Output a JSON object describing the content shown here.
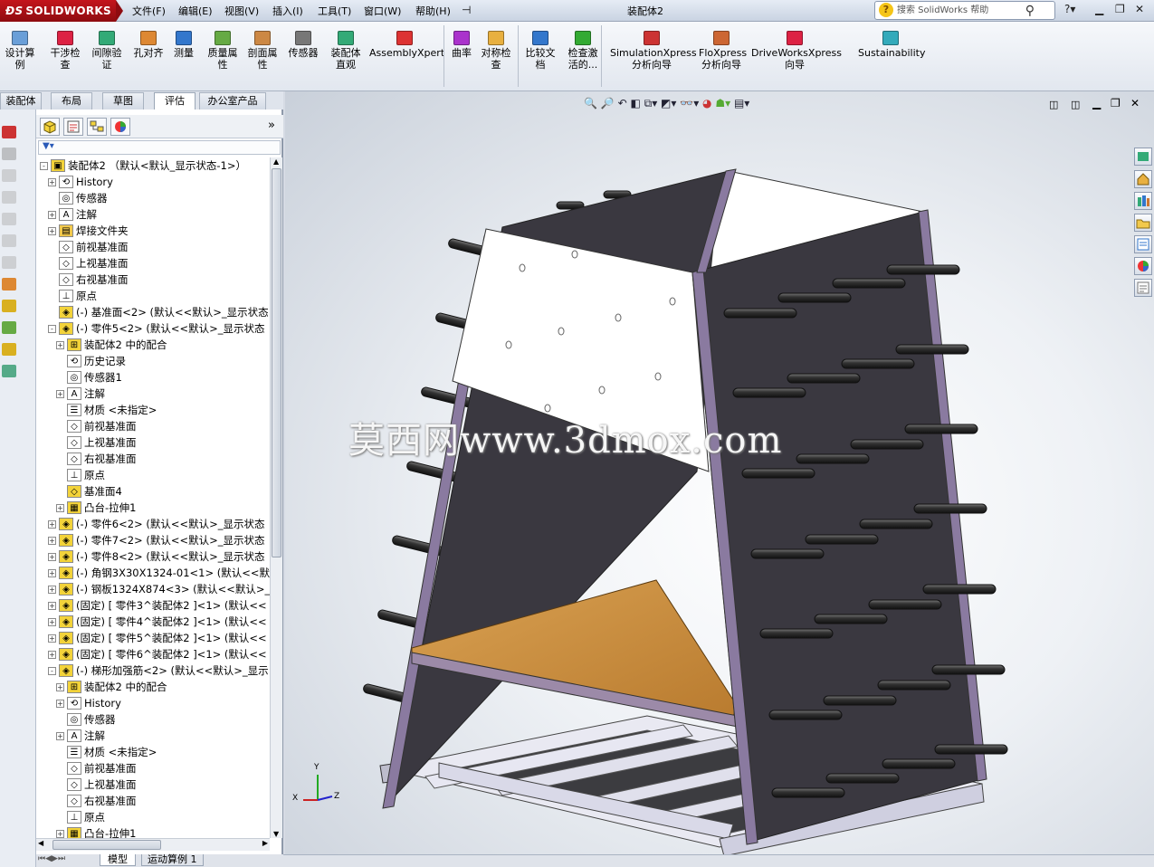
{
  "app": {
    "logo_text": "SOLIDWORKS",
    "window_title": "装配体2",
    "menu": [
      "文件(F)",
      "编辑(E)",
      "视图(V)",
      "插入(I)",
      "工具(T)",
      "窗口(W)",
      "帮助(H)"
    ],
    "help_search_placeholder": "搜索 SolidWorks 帮助"
  },
  "toolbar": {
    "items": [
      {
        "label1": "设计算",
        "label2": "例",
        "icon": "design-study-icon"
      },
      {
        "label1": "干涉检",
        "label2": "查",
        "icon": "interference-icon"
      },
      {
        "label1": "间隙验",
        "label2": "证",
        "icon": "clearance-icon"
      },
      {
        "label1": "孔对齐",
        "label2": "",
        "icon": "hole-align-icon"
      },
      {
        "label1": "测量",
        "label2": "",
        "icon": "measure-icon"
      },
      {
        "label1": "质量属",
        "label2": "性",
        "icon": "mass-props-icon"
      },
      {
        "label1": "剖面属",
        "label2": "性",
        "icon": "section-props-icon"
      },
      {
        "label1": "传感器",
        "label2": "",
        "icon": "sensor-icon"
      },
      {
        "label1": "装配体",
        "label2": "直观",
        "icon": "assembly-visual-icon"
      },
      {
        "label1": "AssemblyXpert",
        "label2": "",
        "icon": "assemblyxpert-icon"
      },
      {
        "label1": "曲率",
        "label2": "",
        "icon": "curvature-icon"
      },
      {
        "label1": "对称检",
        "label2": "查",
        "icon": "symmetry-icon"
      },
      {
        "label1": "比较文",
        "label2": "档",
        "icon": "compare-icon"
      },
      {
        "label1": "检查激",
        "label2": "活的...",
        "icon": "check-icon"
      },
      {
        "label1": "SimulationXpress",
        "label2": "分析向导",
        "icon": "simulation-icon"
      },
      {
        "label1": "FloXpress",
        "label2": "分析向导",
        "icon": "floxpress-icon"
      },
      {
        "label1": "DriveWorksXpress",
        "label2": "向导",
        "icon": "driveworks-icon"
      },
      {
        "label1": "Sustainability",
        "label2": "",
        "icon": "sustainability-icon"
      }
    ]
  },
  "cmd_tabs": [
    "装配体",
    "布局",
    "草图",
    "评估",
    "办公室产品"
  ],
  "tree": [
    {
      "text": "装配体2 （默认<默认_显示状态-1>）",
      "indent": 0,
      "exp": "-",
      "icon": "assembly-icon"
    },
    {
      "text": "History",
      "indent": 1,
      "exp": "+",
      "icon": "history-icon"
    },
    {
      "text": "传感器",
      "indent": 1,
      "exp": "",
      "icon": "sensor-icon"
    },
    {
      "text": "注解",
      "indent": 1,
      "exp": "+",
      "icon": "annotation-icon"
    },
    {
      "text": "焊接文件夹",
      "indent": 1,
      "exp": "+",
      "icon": "weldment-folder-icon"
    },
    {
      "text": "前视基准面",
      "indent": 1,
      "exp": "",
      "icon": "plane-icon"
    },
    {
      "text": "上视基准面",
      "indent": 1,
      "exp": "",
      "icon": "plane-icon"
    },
    {
      "text": "右视基准面",
      "indent": 1,
      "exp": "",
      "icon": "plane-icon"
    },
    {
      "text": "原点",
      "indent": 1,
      "exp": "",
      "icon": "origin-icon"
    },
    {
      "text": "(-) 基准面<2> (默认<<默认>_显示状态",
      "indent": 1,
      "exp": "",
      "icon": "part-icon"
    },
    {
      "text": "(-) 零件5<2> (默认<<默认>_显示状态",
      "indent": 1,
      "exp": "-",
      "icon": "part-icon"
    },
    {
      "text": "装配体2 中的配合",
      "indent": 2,
      "exp": "+",
      "icon": "mates-icon"
    },
    {
      "text": "历史记录",
      "indent": 2,
      "exp": "",
      "icon": "history-icon"
    },
    {
      "text": "传感器1",
      "indent": 2,
      "exp": "",
      "icon": "sensor-icon"
    },
    {
      "text": "注解",
      "indent": 2,
      "exp": "+",
      "icon": "annotation-icon"
    },
    {
      "text": "材质 <未指定>",
      "indent": 2,
      "exp": "",
      "icon": "material-icon"
    },
    {
      "text": "前视基准面",
      "indent": 2,
      "exp": "",
      "icon": "plane-icon"
    },
    {
      "text": "上视基准面",
      "indent": 2,
      "exp": "",
      "icon": "plane-icon"
    },
    {
      "text": "右视基准面",
      "indent": 2,
      "exp": "",
      "icon": "plane-icon"
    },
    {
      "text": "原点",
      "indent": 2,
      "exp": "",
      "icon": "origin-icon"
    },
    {
      "text": "基准面4",
      "indent": 2,
      "exp": "",
      "icon": "plane-yellow-icon"
    },
    {
      "text": "凸台-拉伸1",
      "indent": 2,
      "exp": "+",
      "icon": "extrude-icon"
    },
    {
      "text": "(-) 零件6<2> (默认<<默认>_显示状态",
      "indent": 1,
      "exp": "+",
      "icon": "part-icon"
    },
    {
      "text": "(-) 零件7<2> (默认<<默认>_显示状态",
      "indent": 1,
      "exp": "+",
      "icon": "part-icon"
    },
    {
      "text": "(-) 零件8<2> (默认<<默认>_显示状态",
      "indent": 1,
      "exp": "+",
      "icon": "part-icon"
    },
    {
      "text": "(-) 角钢3X30X1324-01<1> (默认<<默",
      "indent": 1,
      "exp": "+",
      "icon": "part-icon"
    },
    {
      "text": "(-) 钢板1324X874<3> (默认<<默认>_",
      "indent": 1,
      "exp": "+",
      "icon": "part-icon"
    },
    {
      "text": "(固定) [ 零件3^装配体2 ]<1> (默认<<",
      "indent": 1,
      "exp": "+",
      "icon": "part-icon"
    },
    {
      "text": "(固定) [ 零件4^装配体2 ]<1> (默认<<",
      "indent": 1,
      "exp": "+",
      "icon": "part-icon"
    },
    {
      "text": "(固定) [ 零件5^装配体2 ]<1> (默认<<",
      "indent": 1,
      "exp": "+",
      "icon": "part-icon"
    },
    {
      "text": "(固定) [ 零件6^装配体2 ]<1> (默认<<",
      "indent": 1,
      "exp": "+",
      "icon": "part-icon"
    },
    {
      "text": "(-) 梯形加强筋<2> (默认<<默认>_显示",
      "indent": 1,
      "exp": "-",
      "icon": "part-icon"
    },
    {
      "text": "装配体2 中的配合",
      "indent": 2,
      "exp": "+",
      "icon": "mates-icon"
    },
    {
      "text": "History",
      "indent": 2,
      "exp": "+",
      "icon": "history-icon"
    },
    {
      "text": "传感器",
      "indent": 2,
      "exp": "",
      "icon": "sensor-icon"
    },
    {
      "text": "注解",
      "indent": 2,
      "exp": "+",
      "icon": "annotation-icon"
    },
    {
      "text": "材质 <未指定>",
      "indent": 2,
      "exp": "",
      "icon": "material-icon"
    },
    {
      "text": "前视基准面",
      "indent": 2,
      "exp": "",
      "icon": "plane-icon"
    },
    {
      "text": "上视基准面",
      "indent": 2,
      "exp": "",
      "icon": "plane-icon"
    },
    {
      "text": "右视基准面",
      "indent": 2,
      "exp": "",
      "icon": "plane-icon"
    },
    {
      "text": "原点",
      "indent": 2,
      "exp": "",
      "icon": "origin-icon"
    },
    {
      "text": "凸台-拉伸1",
      "indent": 2,
      "exp": "+",
      "icon": "extrude-icon"
    }
  ],
  "bottom_tabs": [
    "模型",
    "运动算例 1"
  ],
  "watermark": "莫西网www.3dmox.com",
  "triad": {
    "x": "X",
    "y": "Y",
    "z": "Z"
  },
  "colors": {
    "accent": "#c4151c",
    "panel_dark": "#3a3840",
    "frame": "#8a7aa0",
    "wood": "#c98a3a"
  }
}
